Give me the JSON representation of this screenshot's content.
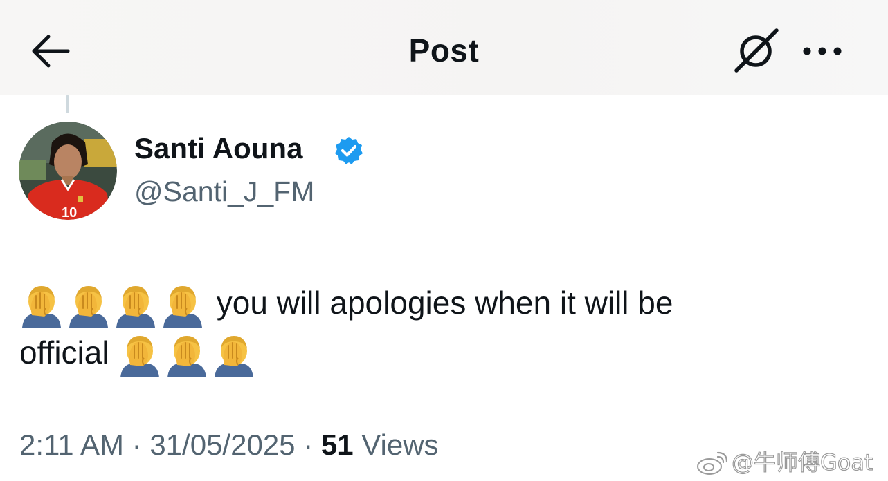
{
  "header": {
    "title": "Post",
    "back_icon": "arrow-left-icon",
    "grok_icon": "grok-icon",
    "more_icon": "more-dots-icon"
  },
  "author": {
    "display_name": "Santi Aouna",
    "handle": "@Santi_J_FM",
    "verified": true,
    "verified_color": "#1d9bf0"
  },
  "post": {
    "emoji": "🤦‍♂️",
    "text_line1": "you will apologies when it will be",
    "text_line2": "official",
    "leading_emoji_count": 4,
    "trailing_emoji_count": 3
  },
  "meta": {
    "time": "2:11 AM",
    "date": "31/05/2025",
    "views_count": "51",
    "views_label": "Views",
    "separator": "·"
  },
  "watermark": {
    "text": "@牛师傅Goat"
  }
}
